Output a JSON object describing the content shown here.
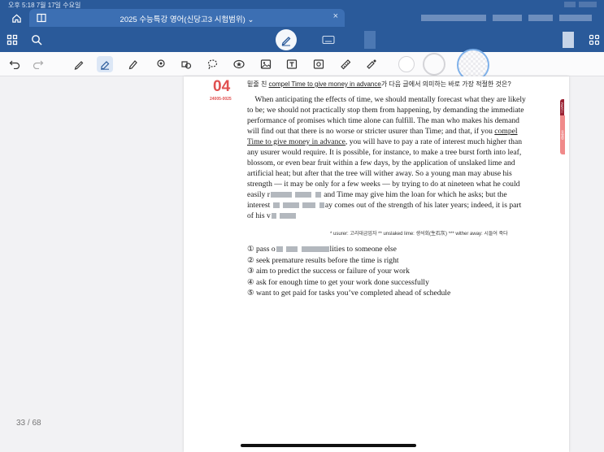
{
  "status": {
    "time": "오후 5:18  7월 17일 수요일"
  },
  "tab": {
    "title": "2025 수능특강 영어(신당고3 시험범위)",
    "chevron": "⌄",
    "close": "×"
  },
  "question": {
    "number": "04",
    "code": "24005-0025",
    "prompt_underlined": "compel Time to give money in advance",
    "prompt_pre": "밑줄 친 ",
    "prompt_post": "가 다음 글에서 의미하는 바로 가장 적절한 것은?",
    "lines": [
      "    When anticipating the effects of time, we should mentally forecast what they are likely",
      "to be; we should not practically stop them from happening, by demanding the immediate",
      "performance of promises which time alone can fulfill. The man who makes his demand",
      "will find out that there is no worse or stricter usurer than Time; and that, if you ",
      "compel",
      "Time to give money in advance",
      ", you will have to pay a rate of interest much higher than",
      "any usurer would require. It is possible, for instance, to make a tree burst forth into leaf,",
      "blossom, or even bear fruit within a few days, by the application of unslaked lime and",
      "artificial heat; but after that the tree will wither away. So a young man may abuse his",
      "strength — it may be only for a few weeks — by trying to do at nineteen what he could",
      "easily r",
      " and Time may give him the loan for which he asks; but the",
      "interest ",
      "ay comes out of the strength of his later years; indeed, it is part",
      "of his v"
    ],
    "gloss": "* usurer: 고리대금업자  ** unslaked lime: 생석회(生石灰)  *** wither away: 시들어 죽다",
    "choices": [
      "① pass o",
      "lities to someone else",
      "② seek premature results before the time is right",
      "③ aim to predict the success or failure of your work",
      "④ ask for enough time to get your work done successfully",
      "⑤ want to get paid for tasks you’ve completed ahead of schedule"
    ],
    "side_tab_a": "PART I",
    "side_tab_b": "유형편"
  },
  "page_indicator": "33 / 68",
  "colors": {
    "chrome": "#2a5a9a",
    "tab_active": "#3c6fb3",
    "accent_red": "#e05050"
  }
}
